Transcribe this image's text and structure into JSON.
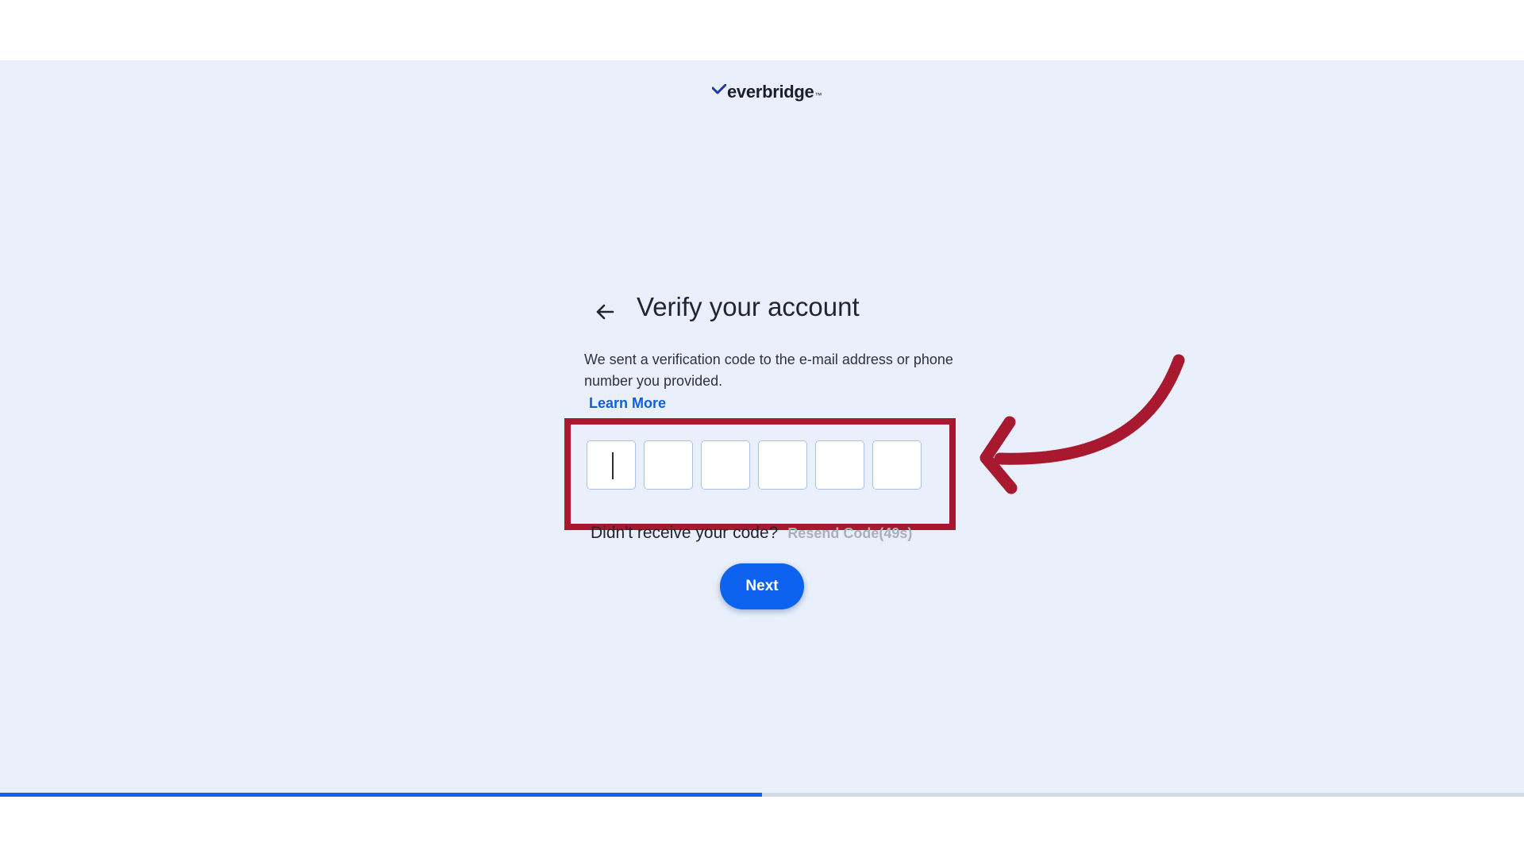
{
  "brand": {
    "name": "everbridge",
    "trademark": "™"
  },
  "page": {
    "title": "Verify your account",
    "description": "We sent a verification code to the e-mail address or phone number you provided.",
    "learn_more_label": "Learn More"
  },
  "code_inputs": {
    "count": 6,
    "values": [
      "",
      "",
      "",
      "",
      "",
      ""
    ],
    "active_index": 0
  },
  "resend": {
    "question": "Didn't receive your code?",
    "link_label": "Resend Code(49s)"
  },
  "actions": {
    "next_label": "Next"
  },
  "progress": {
    "fraction": 0.5
  },
  "annotation": {
    "color": "#a8182f"
  },
  "colors": {
    "accent": "#0d63f0",
    "link": "#0f5fdc",
    "background": "#eaf0fb",
    "disabled_link": "#a8afbd"
  },
  "icons": {
    "back": "arrow-left-icon",
    "logo_mark": "checkmark-icon"
  }
}
